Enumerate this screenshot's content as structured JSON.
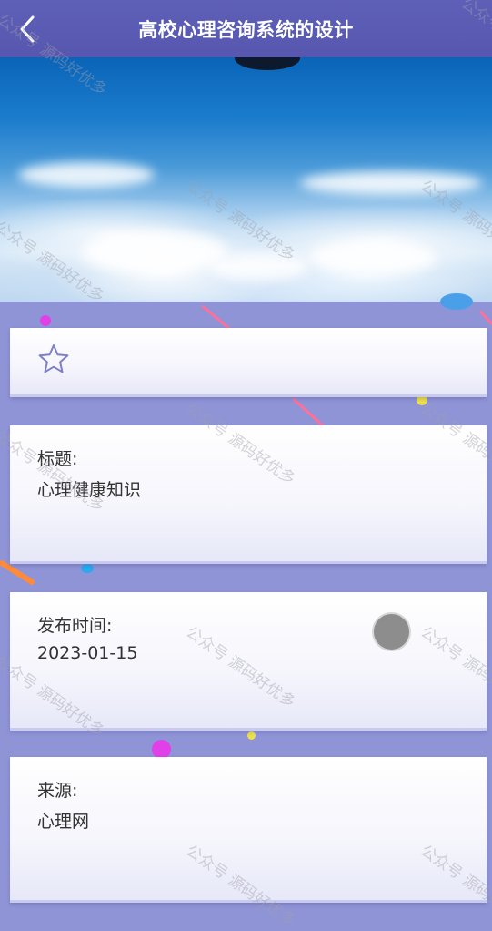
{
  "header": {
    "title": "高校心理咨询系统的设计",
    "back_icon": "chevron-left-icon"
  },
  "favorite": {
    "icon": "star-outline-icon"
  },
  "fields": {
    "title_label": "标题:",
    "title_value": "心理健康知识",
    "time_label": "发布时间:",
    "time_value": "2023-01-15",
    "source_label": "来源:",
    "source_value": "心理网"
  },
  "watermark": {
    "text": "公众号 源码好优多"
  },
  "colors": {
    "header_bg": "#5a5bb3",
    "page_bg": "#8f94d6",
    "card_bg": "#ffffff",
    "text": "#333333",
    "float_button": "#8d8d8d"
  }
}
